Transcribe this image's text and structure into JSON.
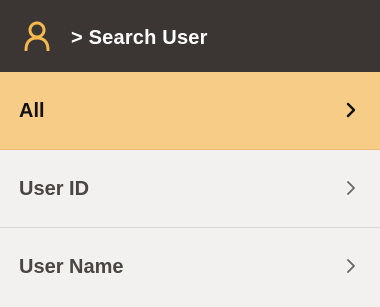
{
  "header": {
    "title": "> Search User",
    "icon": "user-icon",
    "background": "#3b3634",
    "icon_color": "#f6b94d"
  },
  "menu": {
    "items": [
      {
        "label": "All",
        "selected": true,
        "icon": "chevron-right-icon"
      },
      {
        "label": "User ID",
        "selected": false,
        "icon": "chevron-right-icon"
      },
      {
        "label": "User Name",
        "selected": false,
        "icon": "chevron-right-icon"
      }
    ],
    "selected_color": "#f6cc86"
  }
}
